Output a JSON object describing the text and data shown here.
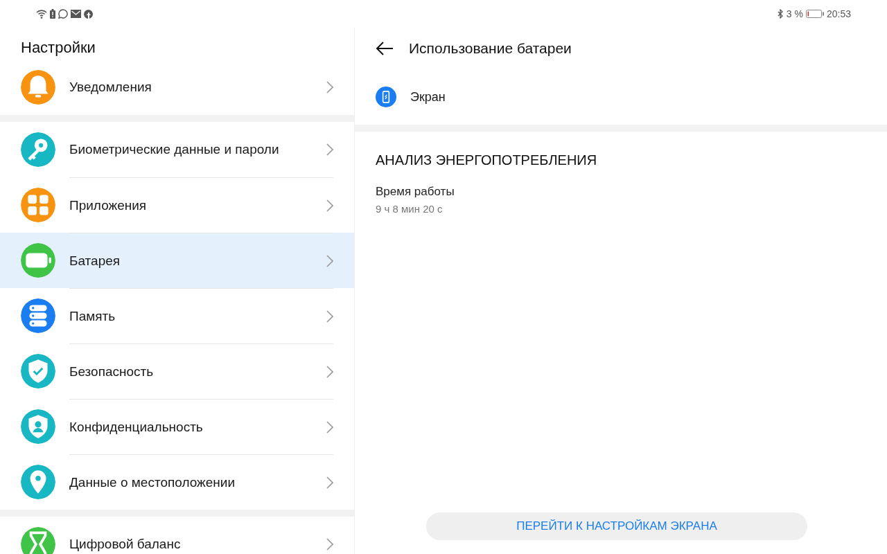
{
  "status_bar": {
    "battery_percent": "3 %",
    "time": "20:53"
  },
  "settings": {
    "title": "Настройки",
    "groups": [
      {
        "items": [
          {
            "label": "Уведомления",
            "kind": "bell",
            "color": "#f7930e",
            "selected": false
          }
        ]
      },
      {
        "items": [
          {
            "label": "Биометрические данные и пароли",
            "kind": "key",
            "color": "#17b8c4",
            "selected": false
          },
          {
            "label": "Приложения",
            "kind": "apps",
            "color": "#f7930e",
            "selected": false
          },
          {
            "label": "Батарея",
            "kind": "battery",
            "color": "#3fc447",
            "selected": true
          },
          {
            "label": "Память",
            "kind": "storage",
            "color": "#1a7ef2",
            "selected": false
          },
          {
            "label": "Безопасность",
            "kind": "shield",
            "color": "#17b8c4",
            "selected": false
          },
          {
            "label": "Конфиденциальность",
            "kind": "privacy",
            "color": "#17b8c4",
            "selected": false
          },
          {
            "label": "Данные о местоположении",
            "kind": "location",
            "color": "#17b8c4",
            "selected": false
          }
        ]
      },
      {
        "items": [
          {
            "label": "Цифровой баланс",
            "kind": "hourglass",
            "color": "#3fc447",
            "selected": false
          }
        ]
      }
    ]
  },
  "detail": {
    "title": "Использование батареи",
    "item": {
      "label": "Экран"
    },
    "section_heading": "АНАЛИЗ ЭНЕРГОПОТРЕБЛЕНИЯ",
    "fields": [
      {
        "label": "Время работы",
        "value": "9 ч 8 мин 20 с"
      }
    ],
    "button": "ПЕРЕЙТИ К НАСТРОЙКАМ ЭКРАНА"
  }
}
